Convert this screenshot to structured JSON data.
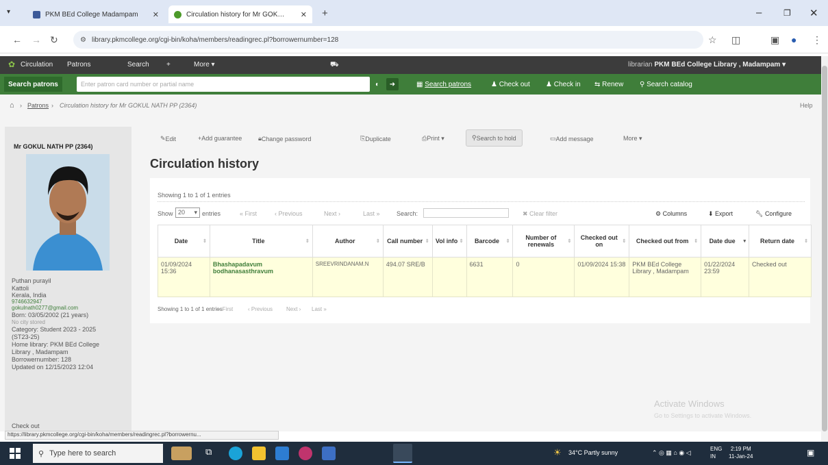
{
  "browser": {
    "tabs": [
      {
        "title": "PKM BEd College Madampam",
        "active": false
      },
      {
        "title": "Circulation history for Mr GOK…",
        "active": true
      }
    ],
    "url": "library.pkmcollege.org/cgi-bin/koha/members/readingrec.pl?borrowernumber=128"
  },
  "nav": {
    "items": [
      "Circulation",
      "Patrons",
      "Search",
      "+",
      "More ▾"
    ],
    "user_prefix": "librarian",
    "library": "PKM BEd College Library , Madampam ▾"
  },
  "search": {
    "button": "Search patrons",
    "placeholder": "Enter patron card number or partial name",
    "links": [
      "Search patrons",
      "Check out",
      "Check in",
      "Renew",
      "Search catalog"
    ]
  },
  "breadcrumb": {
    "home": "⌂",
    "patrons": "Patrons",
    "current": "Circulation history for Mr GOKUL NATH PP (2364)",
    "help": "Help"
  },
  "patron": {
    "name": "Mr GOKUL NATH PP (2364)",
    "lines": [
      "Puthan purayil",
      "Kattoli",
      "Kerala, India",
      "9746632947",
      "gokulnath0277@gmail.com",
      "Born: 03/05/2002 (21 years)",
      "No city stored",
      "Category: Student 2023 - 2025",
      "(ST23-25)",
      "Home library: PKM BEd College",
      "Library , Madampam",
      "Borrowernumber: 128",
      "Updated on 12/15/2023 12:04"
    ],
    "checkout": "Check out"
  },
  "toolbar": [
    "Edit",
    "Add guarantee",
    "Change password",
    "Duplicate",
    "Print ▾",
    "Search to hold",
    "Add message",
    "More ▾"
  ],
  "page_title": "Circulation history",
  "table": {
    "showing_top": "Showing 1 to 1 of 1 entries",
    "show": "Show",
    "show_value": "20",
    "entries": "entries",
    "pager": [
      "« First",
      "‹ Previous",
      "Next ›",
      "Last »"
    ],
    "search_label": "Search:",
    "clear_filter": "Clear filter",
    "tools": [
      "Columns",
      "Export",
      "Configure"
    ],
    "headers": [
      "Date",
      "Title",
      "Author",
      "Call number",
      "Vol info",
      "Barcode",
      "Number of renewals",
      "Checked out on",
      "Checked out from",
      "Date due",
      "Return date"
    ],
    "row": {
      "date": "01/09/2024 15:36",
      "title": "Bhashapadavum bodhanasasthravum",
      "author": "SREEVRINDANAM.N",
      "call": "494.07 SRE/B",
      "vol": "",
      "barcode": "6631",
      "renewals": "0",
      "checked_out_on": "01/09/2024 15:38",
      "from": "PKM BEd College Library , Madampam",
      "due": "01/22/2024 23:59",
      "returned": "Checked out"
    },
    "showing_bottom": "Showing 1 to 1 of 1 entries"
  },
  "status_url": "https://library.pkmcollege.org/cgi-bin/koha/members/readingrec.pl?borrowernu...",
  "watermark": {
    "title": "Activate Windows",
    "sub": "Go to Settings to activate Windows."
  },
  "taskbar": {
    "search": "Type here to search",
    "weather": "34°C  Partly sunny",
    "lang1": "ENG",
    "lang2": "IN",
    "time": "2:19 PM",
    "date": "11-Jan-24"
  }
}
